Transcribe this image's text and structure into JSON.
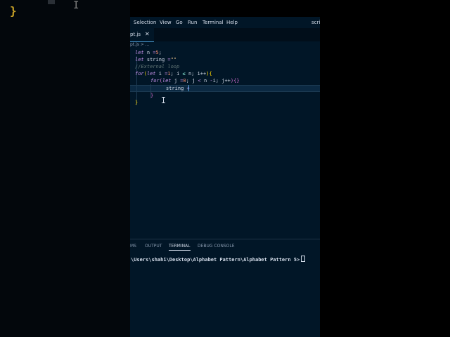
{
  "window": {
    "title_fragment": "scrip"
  },
  "menu": [
    "Selection",
    "View",
    "Go",
    "Run",
    "Terminal",
    "Help"
  ],
  "tab": {
    "name": "pt.js",
    "close": "✕"
  },
  "breadcrumb": "pt.js > ...",
  "code": [
    [
      "let",
      "n",
      "=",
      "5",
      ";"
    ],
    [
      "let",
      "string",
      "=",
      "\"\""
    ],
    [
      "//External loop"
    ],
    [
      "for",
      "(",
      "let",
      "i",
      "=",
      "1",
      ";",
      "i",
      "≤",
      "n",
      ";",
      "i++",
      ")",
      "{"
    ],
    [
      "for",
      "(",
      "let",
      "j",
      "=",
      "0",
      ";",
      "j",
      "<",
      "n",
      "-",
      "i",
      ";",
      "j++",
      ")",
      "{",
      "}"
    ],
    [
      "string",
      "+"
    ],
    [
      "}"
    ],
    [
      "}"
    ]
  ],
  "panel": {
    "tabs": [
      "MS",
      "OUTPUT",
      "TERMINAL",
      "DEBUG CONSOLE"
    ],
    "active_tab": "TERMINAL",
    "terminal_line": "\\Users\\shahi\\Desktop\\Alphabet Pattern\\Alphabet Pattern 5>"
  },
  "colors": {
    "editor_bg": "#011627",
    "keyword": "#c792ea",
    "number": "#f78c6c",
    "comment": "#637777"
  }
}
